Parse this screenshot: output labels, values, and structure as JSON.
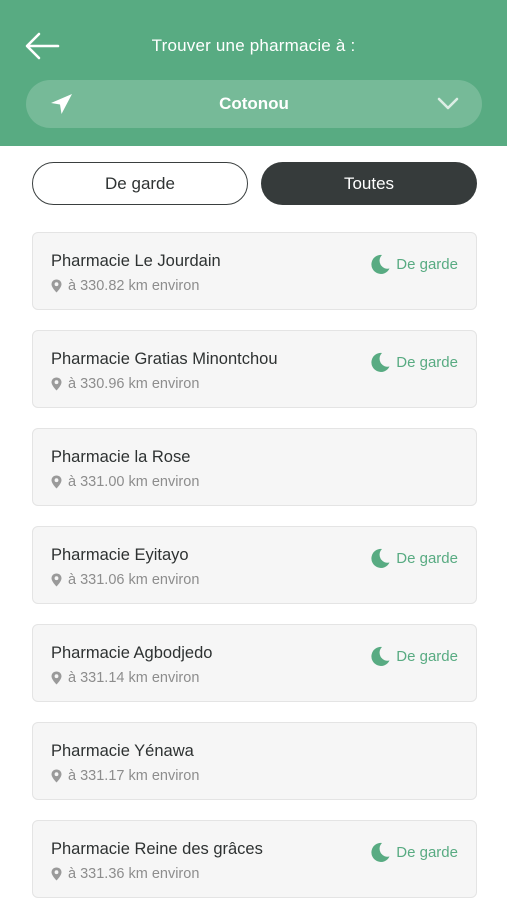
{
  "header": {
    "title": "Trouver une pharmacie à :",
    "city": "Cotonou"
  },
  "filters": {
    "on_duty_label": "De garde",
    "all_label": "Toutes",
    "selected": "Toutes"
  },
  "colors": {
    "brand_green": "#58ab82",
    "dark": "#363b3b"
  },
  "pharmacies": [
    {
      "name": "Pharmacie Le Jourdain",
      "distance": "à 330.82 km environ",
      "badge": "De garde"
    },
    {
      "name": "Pharmacie Gratias Minontchou",
      "distance": "à 330.96 km environ",
      "badge": "De garde"
    },
    {
      "name": "Pharmacie la Rose",
      "distance": "à 331.00 km environ",
      "badge": ""
    },
    {
      "name": "Pharmacie Eyitayo",
      "distance": "à 331.06 km environ",
      "badge": "De garde"
    },
    {
      "name": "Pharmacie Agbodjedo",
      "distance": "à 331.14 km environ",
      "badge": "De garde"
    },
    {
      "name": "Pharmacie Yénawa",
      "distance": "à 331.17 km environ",
      "badge": ""
    },
    {
      "name": "Pharmacie Reine des grâces",
      "distance": "à 331.36 km environ",
      "badge": "De garde"
    }
  ],
  "icons": {
    "back": "arrow-left-icon",
    "location": "location-arrow-icon",
    "dropdown": "chevron-down-icon",
    "pin": "map-pin-icon",
    "on_duty": "moon-icon"
  }
}
